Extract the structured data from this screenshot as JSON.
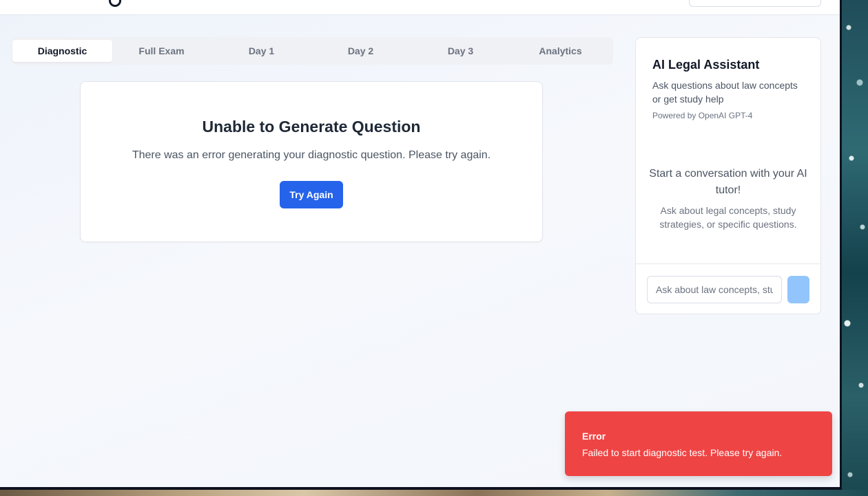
{
  "tabs": [
    {
      "label": "Diagnostic",
      "active": true
    },
    {
      "label": "Full Exam",
      "active": false
    },
    {
      "label": "Day 1",
      "active": false
    },
    {
      "label": "Day 2",
      "active": false
    },
    {
      "label": "Day 3",
      "active": false
    },
    {
      "label": "Analytics",
      "active": false
    }
  ],
  "error_card": {
    "title": "Unable to Generate Question",
    "message": "There was an error generating your diagnostic question. Please try again.",
    "button_label": "Try Again"
  },
  "assistant": {
    "title": "AI Legal Assistant",
    "description": "Ask questions about law concepts or get study help",
    "powered_by": "Powered by OpenAI GPT-4",
    "empty_title": "Start a conversation with your AI tutor!",
    "empty_subtitle": "Ask about legal concepts, study strategies, or specific questions.",
    "input_placeholder": "Ask about law concepts, study strategies...",
    "input_value": ""
  },
  "toast": {
    "title": "Error",
    "message": "Failed to start diagnostic test. Please try again.",
    "color": "#ef4444"
  },
  "colors": {
    "primary": "#2563eb",
    "send_button_disabled": "#93c5fd"
  }
}
